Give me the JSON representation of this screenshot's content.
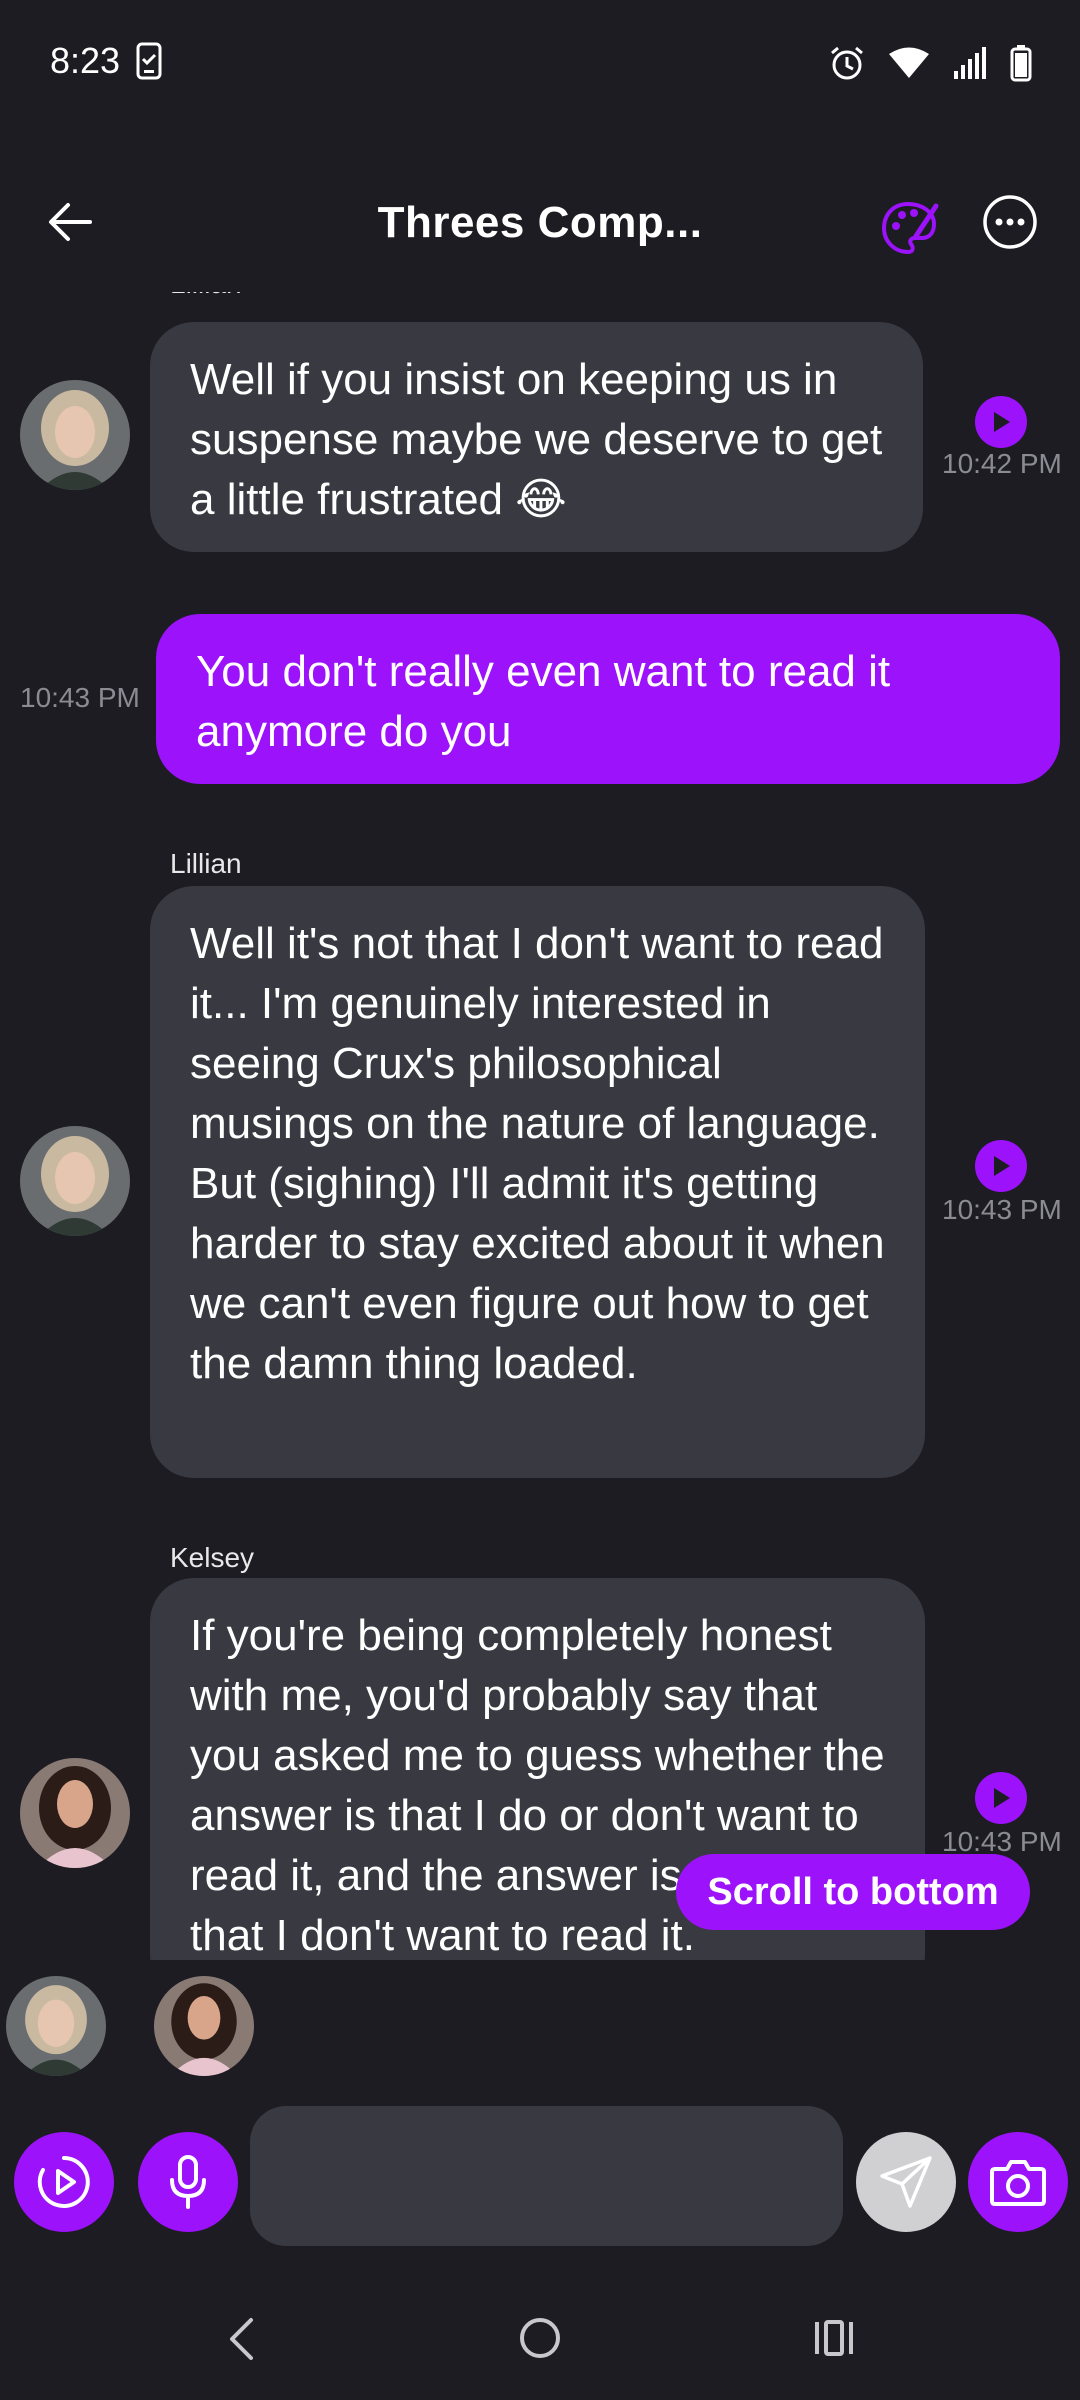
{
  "status": {
    "time": "8:23"
  },
  "header": {
    "title": "Threes Comp..."
  },
  "messages": [
    {
      "sender": "Lillian",
      "text": "Well if you insist on keeping us in suspense maybe we deserve to get a little frustrated 😂",
      "time": "10:42 PM"
    },
    {
      "sender": "",
      "text": "You don't really even want to read it anymore do you",
      "time": "10:43 PM"
    },
    {
      "sender": "Lillian",
      "text": "Well it's not that I don't want to read it... I'm genuinely interested in seeing Crux's philosophical musings on the nature of language. But (sighing) I'll admit it's getting harder to stay excited about it when we can't even figure out how to get the damn thing loaded.",
      "time": "10:43 PM"
    },
    {
      "sender": "Kelsey",
      "text": "If you're being completely honest with me, you'd probably say that you asked me to guess whether the answer is that I do or don't want to read it, and the answer is clearly that I don't want to read it.",
      "time": "10:43 PM"
    }
  ],
  "scroll_button": {
    "label": "Scroll to bottom"
  },
  "composer": {
    "placeholder": ""
  },
  "colors": {
    "background": "#1c1c22",
    "bubble_other": "#393a41",
    "bubble_mine": "#9b12fb",
    "accent": "#9b12fb",
    "timestamp": "#8b8b93"
  }
}
